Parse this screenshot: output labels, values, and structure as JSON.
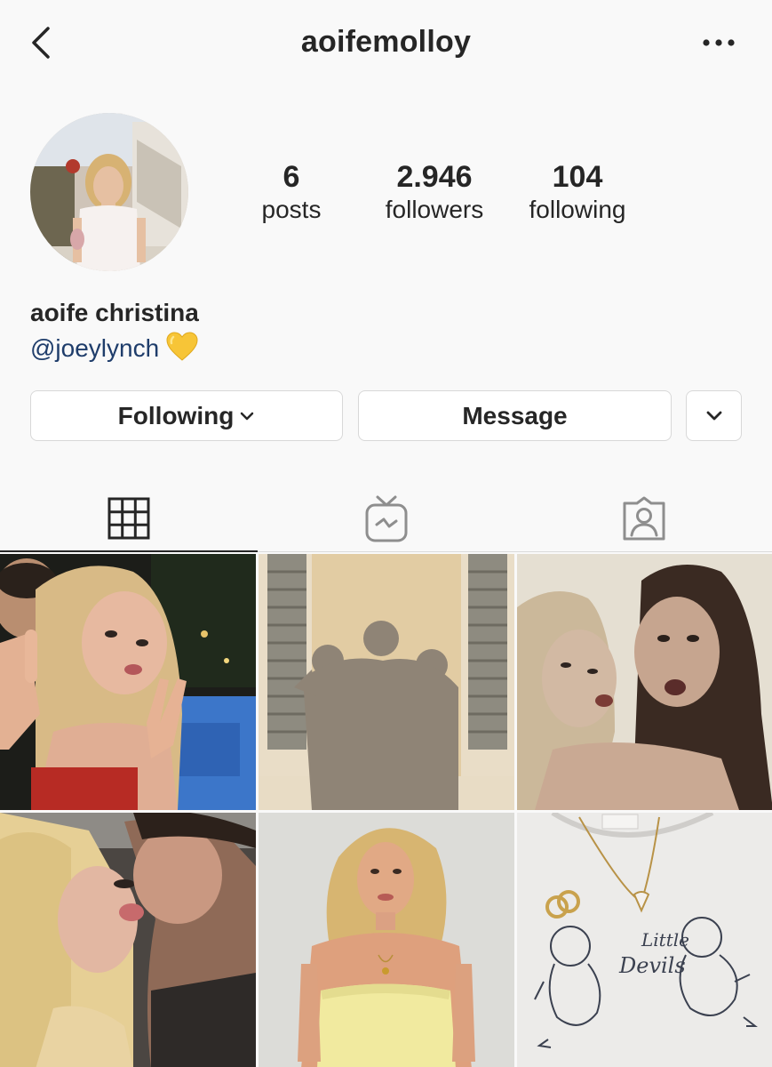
{
  "header": {
    "username": "aoifemolloy",
    "back_icon": "chevron-left-icon",
    "more_icon": "ellipsis-icon"
  },
  "profile": {
    "stats": {
      "posts_count": "6",
      "posts_label": "posts",
      "followers_count": "2.946",
      "followers_label": "followers",
      "following_count": "104",
      "following_label": "following"
    },
    "full_name": "aoife christina",
    "bio_mention": "@joeylynch",
    "bio_emoji": "yellow-heart"
  },
  "actions": {
    "following_label": "Following",
    "message_label": "Message"
  },
  "tabs": [
    {
      "name": "grid",
      "icon": "grid-icon",
      "active": true
    },
    {
      "name": "igtv",
      "icon": "igtv-icon",
      "active": false
    },
    {
      "name": "tagged",
      "icon": "tagged-person-icon",
      "active": false
    }
  ],
  "posts": [
    {
      "subject": "selfie-peace-sign"
    },
    {
      "subject": "shadow-on-wall"
    },
    {
      "subject": "two-girls-sepia"
    },
    {
      "subject": "kiss-closeup"
    },
    {
      "subject": "yellow-dress-portrait"
    },
    {
      "subject": "little-devils-shirt"
    }
  ],
  "post_texts": {
    "shirt_line1": "Little",
    "shirt_line2": "Devils"
  },
  "colors": {
    "mention": "#1f3d6b",
    "heart": "#f7c537",
    "background": "#f9f9f9"
  }
}
